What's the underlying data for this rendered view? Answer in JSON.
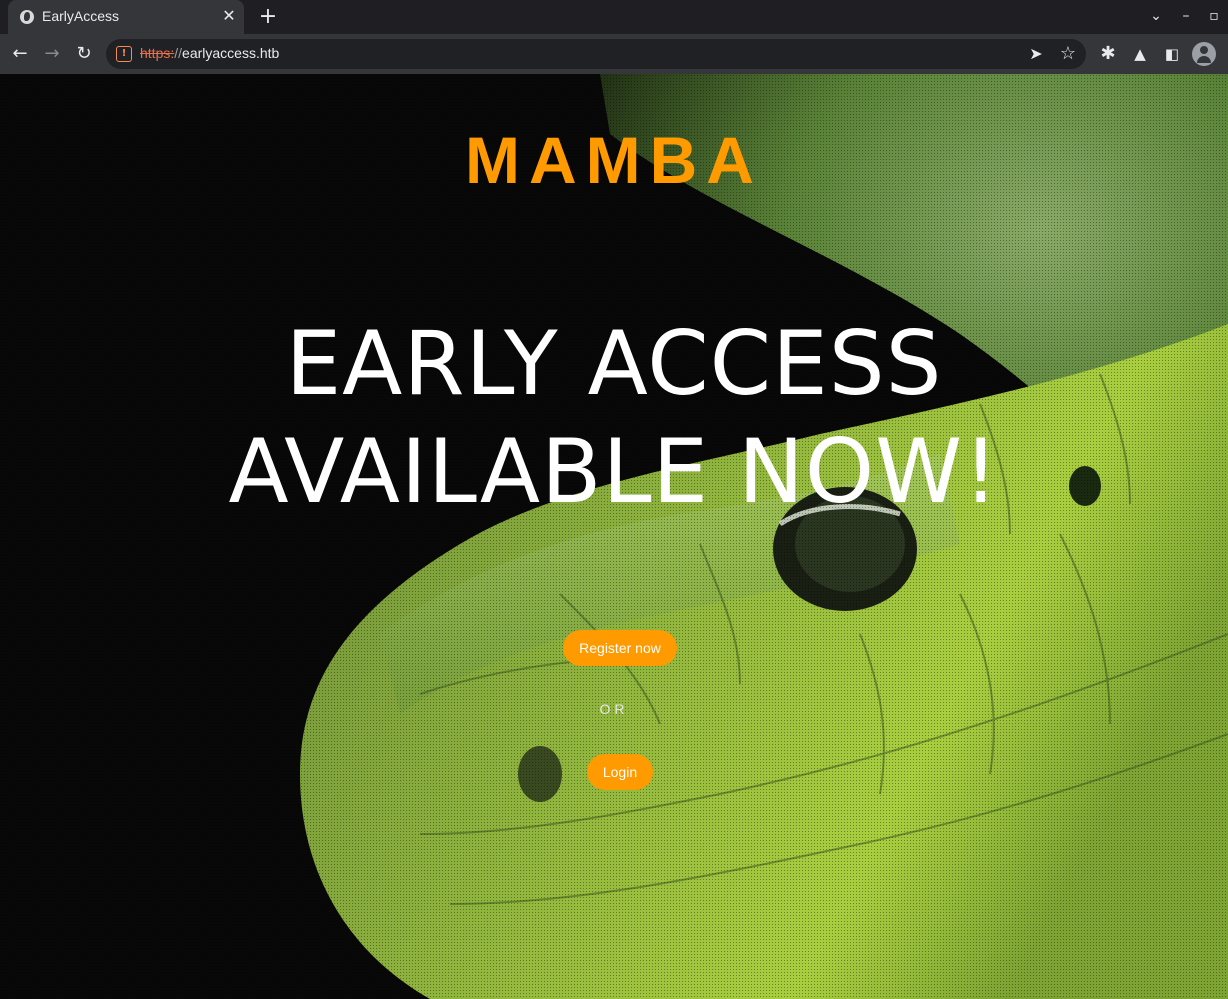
{
  "browser": {
    "tab_title": "EarlyAccess",
    "tab_close_icon": "close-icon",
    "new_tab_icon": "plus-icon",
    "url_scheme": "https:",
    "url_separator": "//",
    "url_host": "earlyaccess.htb",
    "security_icon": "not-secure-icon",
    "toolbar_icons": [
      "back-icon",
      "forward-icon",
      "reload-icon",
      "send-icon",
      "star-icon",
      "extensions-icon",
      "labs-icon",
      "side-panel-icon",
      "profile-icon"
    ],
    "window_controls": [
      "chevron-down-icon",
      "minimize-icon",
      "maximize-icon"
    ]
  },
  "page": {
    "brand": "MAMBA",
    "headline_line1": "EARLY ACCESS",
    "headline_line2": "AVAILABLE NOW!",
    "register_label": "Register now",
    "or_label": "OR",
    "login_label": "Login",
    "background": "snake-photo"
  },
  "colors": {
    "accent": "#ff9a00",
    "headline": "#ffffff",
    "chrome_dark": "#1f1f23",
    "chrome_toolbar": "#35363a",
    "insecure_scheme": "#e8704a"
  }
}
